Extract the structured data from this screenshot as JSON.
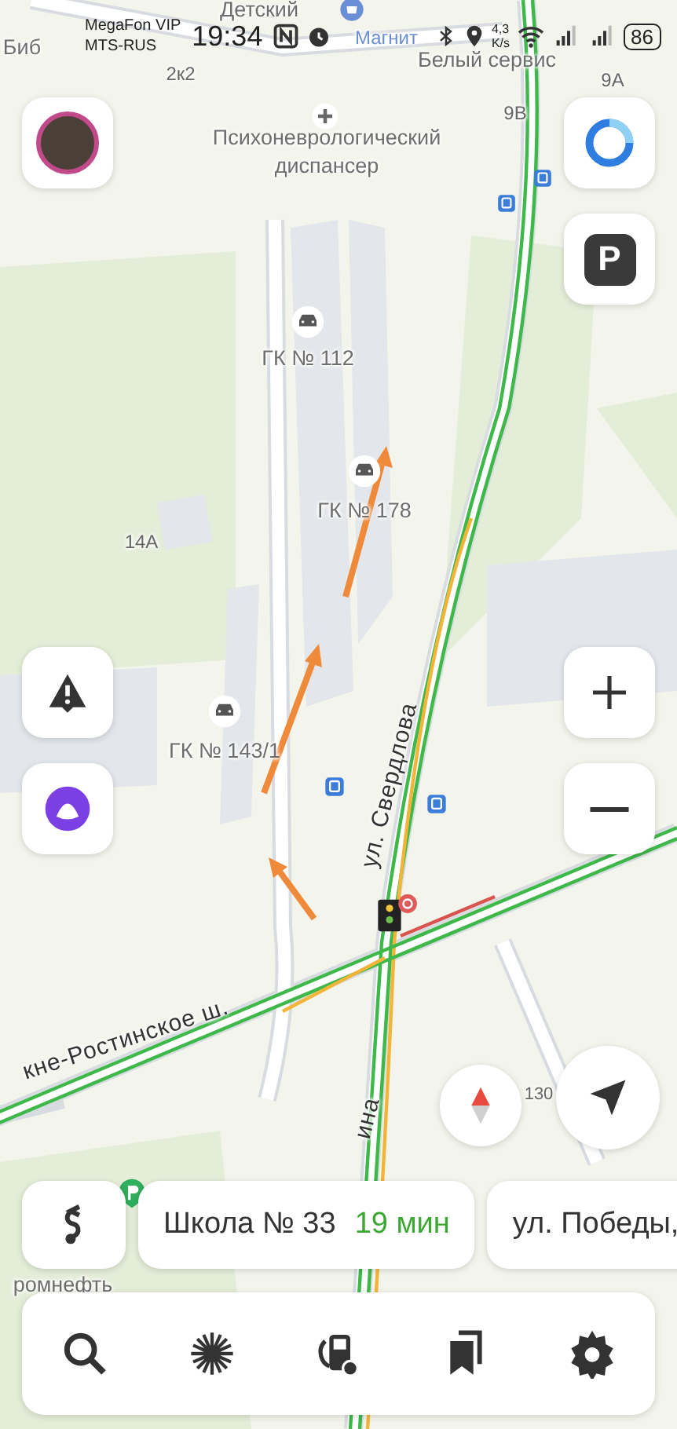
{
  "status_bar": {
    "carriers": [
      "MegaFon VIP",
      "MTS-RUS"
    ],
    "time": "19:34",
    "speed": "4,3",
    "speed_unit": "K/s",
    "battery": "86"
  },
  "map_labels": [
    {
      "text": "Детский",
      "kind": "place"
    },
    {
      "text": "Биб",
      "kind": "place"
    },
    {
      "text": "Магнит",
      "kind": "shop"
    },
    {
      "text": "Белый сервис",
      "kind": "place"
    },
    {
      "text": "2к2",
      "kind": "house"
    },
    {
      "text": "9А",
      "kind": "house"
    },
    {
      "text": "9В",
      "kind": "house"
    },
    {
      "text": "Психоневрологический диспансер",
      "kind": "place"
    },
    {
      "text": "ГК № 112",
      "kind": "place"
    },
    {
      "text": "ГК № 178",
      "kind": "place"
    },
    {
      "text": "14А",
      "kind": "house"
    },
    {
      "text": "ГК № 143/1",
      "kind": "place"
    },
    {
      "text": "ул. Свердлова",
      "kind": "street"
    },
    {
      "text": "кне-Ростинское ш.",
      "kind": "street"
    },
    {
      "text": "130",
      "kind": "house"
    },
    {
      "text": "ина",
      "kind": "street"
    },
    {
      "text": "ромнефть",
      "kind": "place"
    }
  ],
  "parking_button": {
    "label": "P"
  },
  "routes": [
    {
      "destination": "Школа № 33",
      "time": "19 мин"
    },
    {
      "destination": "ул. Победы,"
    }
  ],
  "toolbar": [
    {
      "kind": "search"
    },
    {
      "kind": "navigator"
    },
    {
      "kind": "fuel"
    },
    {
      "kind": "bookmarks"
    },
    {
      "kind": "settings"
    }
  ]
}
